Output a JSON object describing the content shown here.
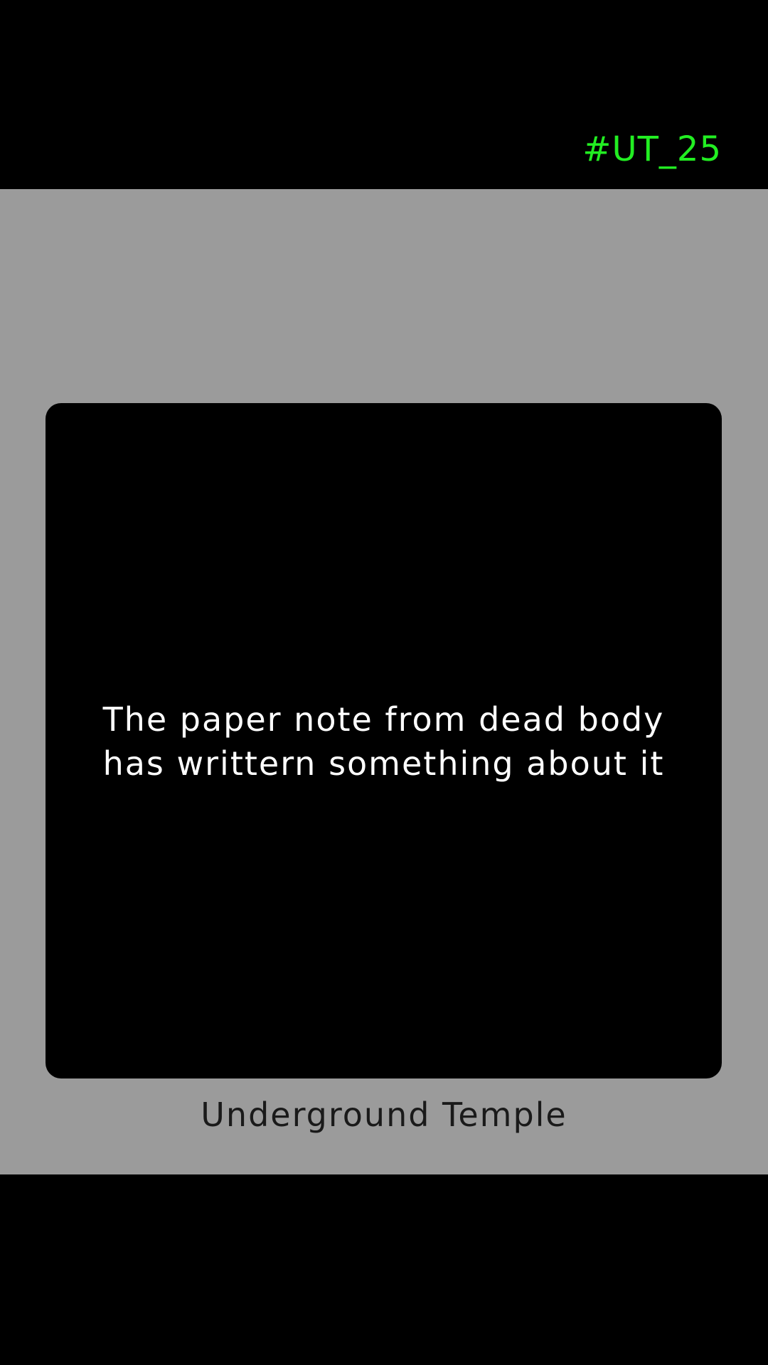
{
  "header": {
    "code": "#UT_25",
    "code_color": "#22ee22"
  },
  "note": {
    "text": "The paper note from dead body\nhas writtern something about it"
  },
  "location": {
    "name": "Underground Temple"
  },
  "colors": {
    "background": "#000000",
    "card_area": "#9b9b9b",
    "panel": "#000000",
    "note_text": "#ffffff",
    "location_text": "#1a1a1a"
  }
}
